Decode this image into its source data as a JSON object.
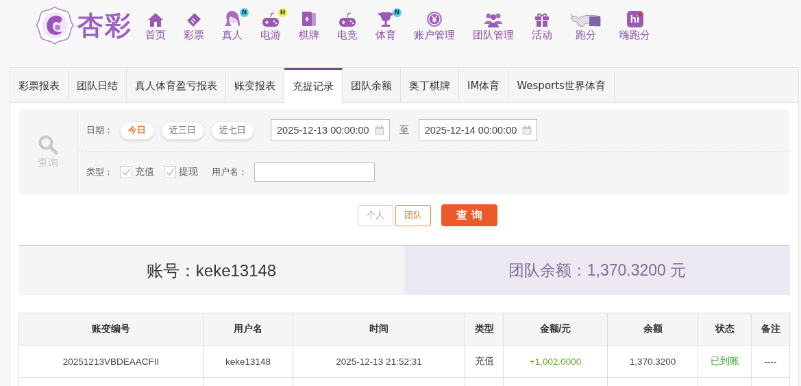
{
  "logo": {
    "text": "杏彩"
  },
  "nav": [
    {
      "label": "首页",
      "kind": "home"
    },
    {
      "label": "彩票",
      "kind": "ticket"
    },
    {
      "label": "真人",
      "kind": "woman",
      "badge": {
        "text": "N",
        "color": "#4dd4ee"
      }
    },
    {
      "label": "电游",
      "kind": "gamepad",
      "badge": {
        "text": "H",
        "color": "#f6f23c"
      }
    },
    {
      "label": "棋牌",
      "kind": "cards"
    },
    {
      "label": "电竞",
      "kind": "gamepad"
    },
    {
      "label": "体育",
      "kind": "trophy",
      "badge": {
        "text": "N",
        "color": "#4dd4ee"
      }
    },
    {
      "label": "账户管理",
      "kind": "yen"
    },
    {
      "label": "团队管理",
      "kind": "team"
    },
    {
      "label": "活动",
      "kind": "gift"
    },
    {
      "label": "跑分",
      "kind": "rhino"
    },
    {
      "label": "嗨跑分",
      "kind": "hi",
      "icon_text": "hi"
    }
  ],
  "tabs": [
    {
      "label": "彩票报表",
      "selected": false
    },
    {
      "label": "团队日结",
      "selected": false
    },
    {
      "label": "真人体育盈亏报表",
      "selected": false
    },
    {
      "label": "账变报表",
      "selected": false
    },
    {
      "label": "充提记录",
      "selected": true
    },
    {
      "label": "团队余额",
      "selected": false
    },
    {
      "label": "奥丁棋牌",
      "selected": false
    },
    {
      "label": "IM体育",
      "selected": false
    },
    {
      "label": "Wesports世界体育",
      "selected": false
    }
  ],
  "filter": {
    "side_label": "查询",
    "date_label": "日期：",
    "date_presets": [
      {
        "label": "今日",
        "selected": true
      },
      {
        "label": "近三日",
        "selected": false
      },
      {
        "label": "近七日",
        "selected": false
      }
    ],
    "start": "2025-12-13 00:00:00",
    "range_sep": "至",
    "end": "2025-12-14 00:00:00",
    "type_label": "类型：",
    "types": [
      {
        "label": "充值",
        "checked": true
      },
      {
        "label": "提现",
        "checked": true
      }
    ],
    "username_label": "用户名："
  },
  "scope": [
    {
      "label": "个人",
      "selected": false
    },
    {
      "label": "团队",
      "selected": true
    }
  ],
  "query_button": "查 询",
  "summary": {
    "account": "账号：keke13148",
    "balance": "团队余额：1,370.3200 元"
  },
  "table": {
    "columns": [
      "账变编号",
      "用户名",
      "时间",
      "类型",
      "金额/元",
      "余额",
      "状态",
      "备注"
    ],
    "rows": [
      [
        "20251213VBDEAACFII",
        "keke13148",
        "2025-12-13 21:52:31",
        "充值",
        "+1,002.0000",
        "1,370.3200",
        "已到账",
        "----"
      ]
    ]
  }
}
